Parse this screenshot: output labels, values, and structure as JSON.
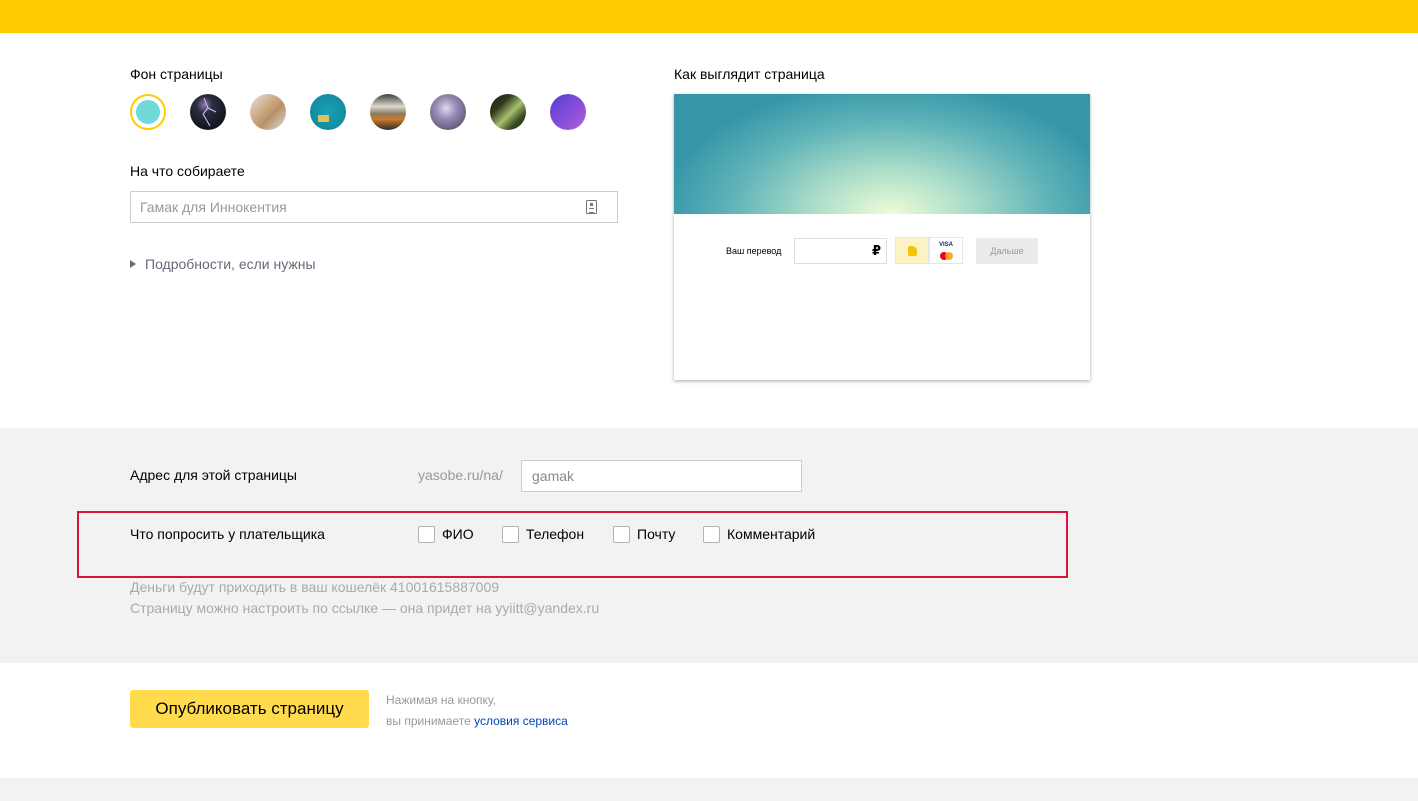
{
  "background_section": {
    "label": "Фон страницы",
    "swatches": [
      {
        "name": "turquoise",
        "color": "#6fdad9",
        "selected": true
      },
      {
        "name": "dark-lightning",
        "color": "#1c2232"
      },
      {
        "name": "beige-paper",
        "color": "#c8a57e"
      },
      {
        "name": "teal-object",
        "color": "#138fa4"
      },
      {
        "name": "landscape",
        "color": "#6e6a5e"
      },
      {
        "name": "purple-space",
        "color": "#837aa2"
      },
      {
        "name": "green-leaf",
        "color": "#4a5e2e"
      },
      {
        "name": "violet-gradient",
        "color": "#7c49d6"
      }
    ]
  },
  "goal": {
    "label": "На что собираете",
    "placeholder": "Гамак для Иннокентия"
  },
  "details_toggle": "Подробности, если нужны",
  "preview": {
    "label": "Как выглядит страница",
    "transfer_label": "Ваш перевод",
    "currency": "₽",
    "card_brand": "VISA",
    "next_button": "Дальше"
  },
  "address": {
    "label": "Адрес для этой страницы",
    "prefix": "yasobe.ru/na/",
    "value": "gamak"
  },
  "ask_payer": {
    "label": "Что попросить у плательщика",
    "options": [
      {
        "label": "ФИО",
        "checked": false
      },
      {
        "label": "Телефон",
        "checked": false
      },
      {
        "label": "Почту",
        "checked": false
      },
      {
        "label": "Комментарий",
        "checked": false
      }
    ]
  },
  "info": {
    "wallet_line": "Деньги будут приходить в ваш кошелёк 41001615887009",
    "settings_line": "Страницу можно настроить по ссылке — она придет на yyiitt@yandex.ru"
  },
  "publish": {
    "button": "Опубликовать страницу",
    "terms_line1": "Нажимая на кнопку,",
    "terms_line2": "вы принимаете",
    "terms_link": "условия сервиса"
  },
  "colors": {
    "brand_yellow": "#ffcc00",
    "button_yellow": "#ffdb4d",
    "highlight_red": "#d8143a",
    "link_blue": "#0044bb"
  }
}
